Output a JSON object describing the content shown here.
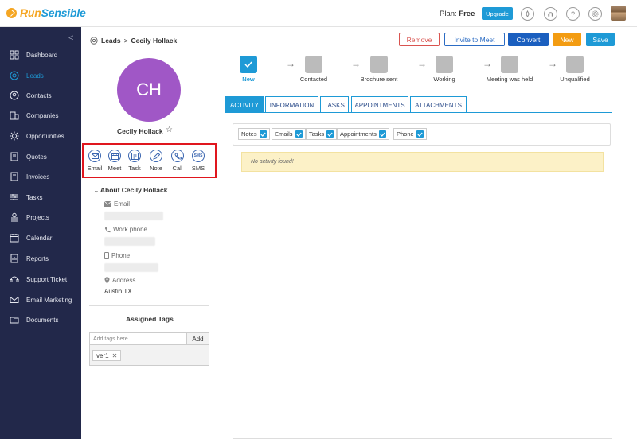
{
  "app": {
    "logo_run": "Run",
    "logo_sensible": "Sensible"
  },
  "header": {
    "plan_label": "Plan:",
    "plan_value": "Free",
    "upgrade_label": "Upgrade",
    "icons": [
      "rocket-icon",
      "headset-icon",
      "help-icon",
      "settings-icon",
      "user-avatar"
    ]
  },
  "sidebar": {
    "collapse_glyph": "<",
    "items": [
      {
        "label": "Dashboard",
        "icon": "dashboard-icon",
        "active": false
      },
      {
        "label": "Leads",
        "icon": "leads-icon",
        "active": true
      },
      {
        "label": "Contacts",
        "icon": "contacts-icon",
        "active": false
      },
      {
        "label": "Companies",
        "icon": "companies-icon",
        "active": false
      },
      {
        "label": "Opportunities",
        "icon": "opportunities-icon",
        "active": false
      },
      {
        "label": "Quotes",
        "icon": "quotes-icon",
        "active": false
      },
      {
        "label": "Invoices",
        "icon": "invoices-icon",
        "active": false
      },
      {
        "label": "Tasks",
        "icon": "tasks-icon",
        "active": false
      },
      {
        "label": "Projects",
        "icon": "projects-icon",
        "active": false
      },
      {
        "label": "Calendar",
        "icon": "calendar-icon",
        "active": false
      },
      {
        "label": "Reports",
        "icon": "reports-icon",
        "active": false
      },
      {
        "label": "Support Ticket",
        "icon": "support-icon",
        "active": false
      },
      {
        "label": "Email Marketing",
        "icon": "email-marketing-icon",
        "active": false
      },
      {
        "label": "Documents",
        "icon": "documents-icon",
        "active": false
      }
    ]
  },
  "breadcrumb": {
    "parent": "Leads",
    "separator": ">",
    "current": "Cecily Hollack"
  },
  "actions": {
    "remove": "Remove",
    "invite": "Invite to Meet",
    "convert": "Convert",
    "new": "New",
    "save": "Save"
  },
  "profile": {
    "initials": "CH",
    "name": "Cecily Hollack",
    "quick_actions": [
      "Email",
      "Meet",
      "Task",
      "Note",
      "Call",
      "SMS"
    ],
    "about_title": "About Cecily Hollack",
    "email_label": "Email",
    "work_phone_label": "Work phone",
    "phone_label": "Phone",
    "address_label": "Address",
    "address_value": "Austin TX"
  },
  "tags": {
    "title": "Assigned Tags",
    "placeholder": "Add tags here...",
    "add_label": "Add",
    "items": [
      "ver1"
    ]
  },
  "pipeline": {
    "stages": [
      "New",
      "Contacted",
      "Brochure sent",
      "Working",
      "Meeting was held",
      "Unqualified"
    ],
    "current": "New"
  },
  "tabs": [
    "ACTIVITY",
    "INFORMATION",
    "TASKS",
    "APPOINTMENTS",
    "ATTACHMENTS"
  ],
  "filters": [
    "Notes",
    "Emails",
    "Tasks",
    "Appointments",
    "Phone"
  ],
  "activity": {
    "empty_message": "No activity found!"
  },
  "colors": {
    "brand_blue": "#1e9ad6",
    "sidebar_bg": "#22284a",
    "avatar_purple": "#a057c6",
    "highlight_red": "#e0161e"
  }
}
